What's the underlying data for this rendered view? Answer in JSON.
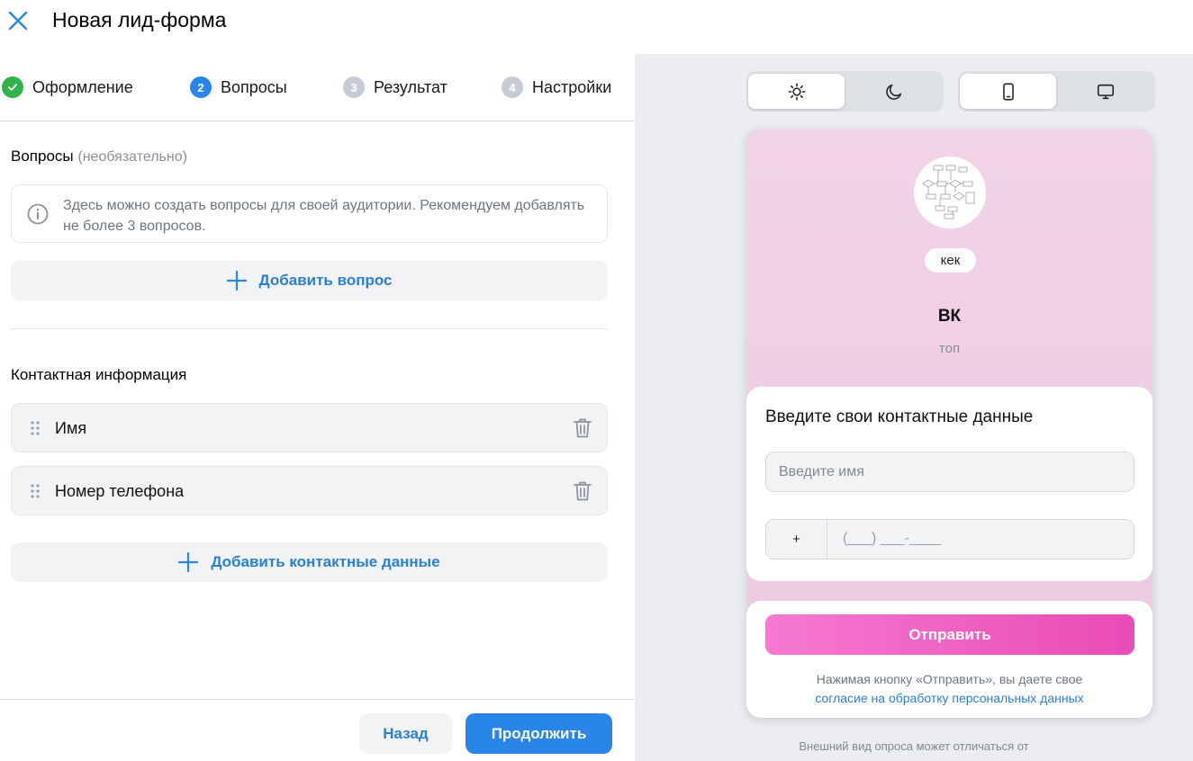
{
  "header": {
    "title": "Новая лид-форма",
    "close_icon": "close-icon"
  },
  "steps": [
    {
      "number": "✓",
      "label": "Оформление",
      "state": "done"
    },
    {
      "number": "2",
      "label": "Вопросы",
      "state": "active"
    },
    {
      "number": "3",
      "label": "Результат",
      "state": "todo"
    },
    {
      "number": "4",
      "label": "Настройки",
      "state": "todo"
    }
  ],
  "questions": {
    "title": "Вопросы",
    "optional": "(необязательно)",
    "info_text": "Здесь можно создать вопросы для своей аудитории. Рекомендуем добавлять не более 3 вопросов.",
    "add_label": "Добавить вопрос"
  },
  "contacts": {
    "title": "Контактная информация",
    "fields": [
      "Имя",
      "Номер телефона"
    ],
    "add_label": "Добавить контактные данные"
  },
  "footer": {
    "back_label": "Назад",
    "next_label": "Продолжить"
  },
  "preview": {
    "theme_light_icon": "sun-icon",
    "theme_dark_icon": "moon-icon",
    "device_mobile_icon": "phone-icon",
    "device_desktop_icon": "monitor-icon",
    "chip": "кек",
    "title": "ВК",
    "subtitle": "топ",
    "card_title": "Введите свои контактные данные",
    "name_placeholder": "Введите имя",
    "phone_prefix": "+",
    "phone_mask": "(___) ___-____",
    "send_label": "Отправить",
    "consent_text": "Нажимая кнопку «Отправить», вы даете свое",
    "consent_link": "согласие на обработку персональных данных",
    "disclaimer": "Внешний вид опроса может отличаться от"
  },
  "colors": {
    "accent": "#2a85e8",
    "done": "#2fb34a",
    "pink_start": "#f57ad0",
    "pink_end": "#e94bb6"
  }
}
